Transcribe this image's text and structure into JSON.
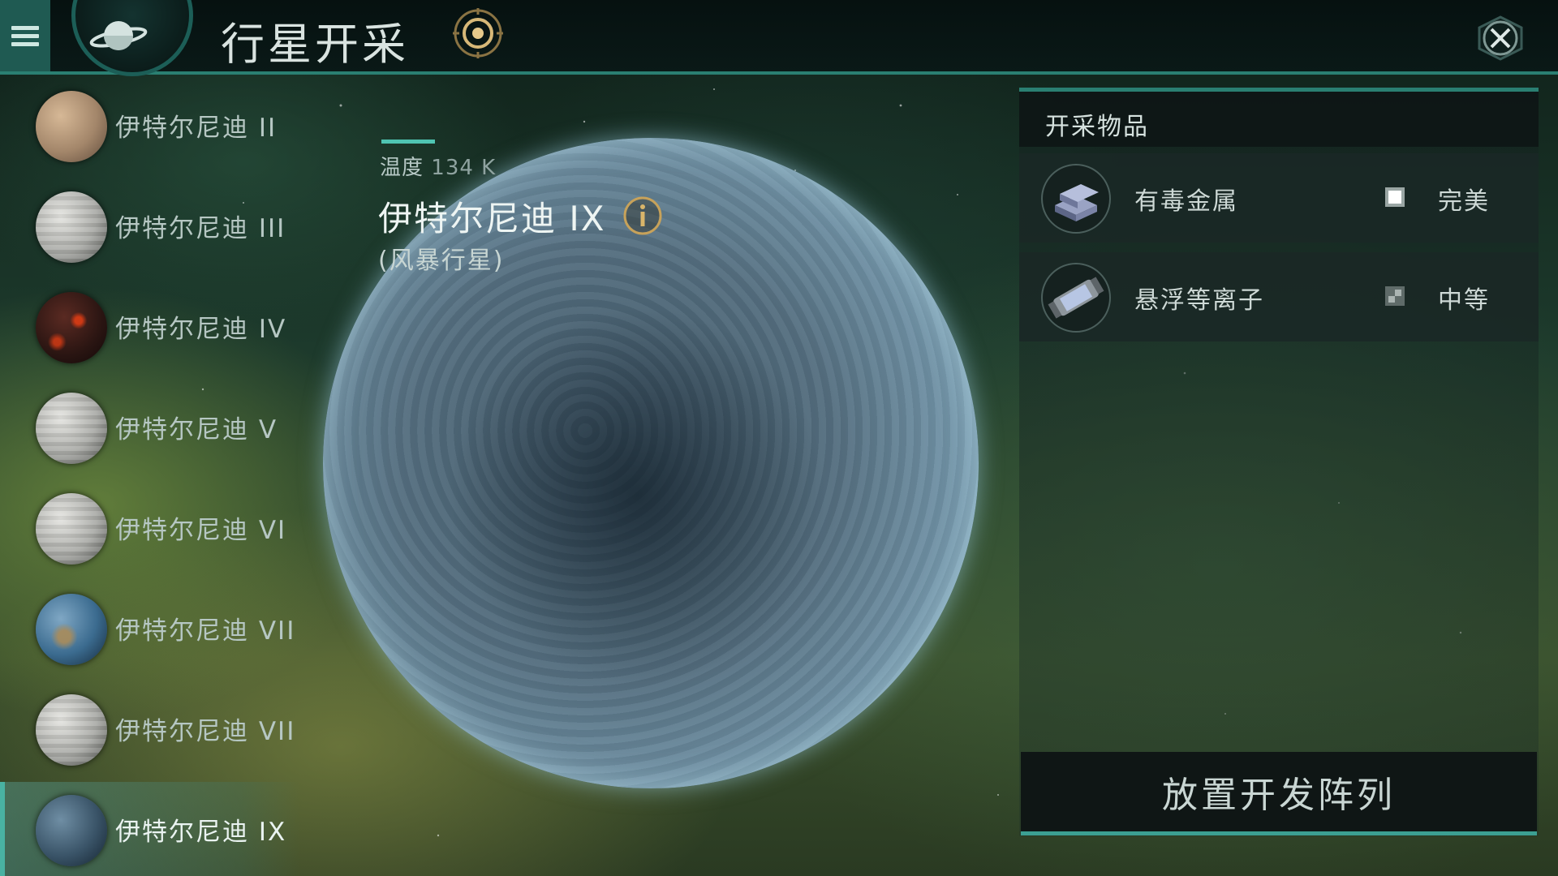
{
  "header": {
    "title": "行星开采"
  },
  "planet_list": [
    {
      "name": "伊特尔尼迪 II",
      "style": "brown",
      "selected": false
    },
    {
      "name": "伊特尔尼迪 III",
      "style": "gray",
      "selected": false
    },
    {
      "name": "伊特尔尼迪 IV",
      "style": "lava",
      "selected": false
    },
    {
      "name": "伊特尔尼迪 V",
      "style": "gray",
      "selected": false
    },
    {
      "name": "伊特尔尼迪 VI",
      "style": "gray",
      "selected": false
    },
    {
      "name": "伊特尔尼迪 VII",
      "style": "earth",
      "selected": false
    },
    {
      "name": "伊特尔尼迪 VII",
      "style": "gray",
      "selected": false
    },
    {
      "name": "伊特尔尼迪 IX",
      "style": "storm",
      "selected": true
    }
  ],
  "planet_info": {
    "temperature_label": "温度",
    "temperature_value": "134 K",
    "name": "伊特尔尼迪 IX",
    "type": "(风暴行星)"
  },
  "resources_panel": {
    "title": "开采物品",
    "items": [
      {
        "name": "有毒金属",
        "quality": "完美",
        "icon": "toxic-metal-icon",
        "quality_icon": "quality-perfect-icon"
      },
      {
        "name": "悬浮等离子",
        "quality": "中等",
        "icon": "suspended-plasma-icon",
        "quality_icon": "quality-medium-icon"
      }
    ],
    "deploy_label": "放置开发阵列"
  },
  "colors": {
    "accent": "#2a7f72",
    "accent_light": "#4fc4b2",
    "gold": "#c7a25a"
  }
}
